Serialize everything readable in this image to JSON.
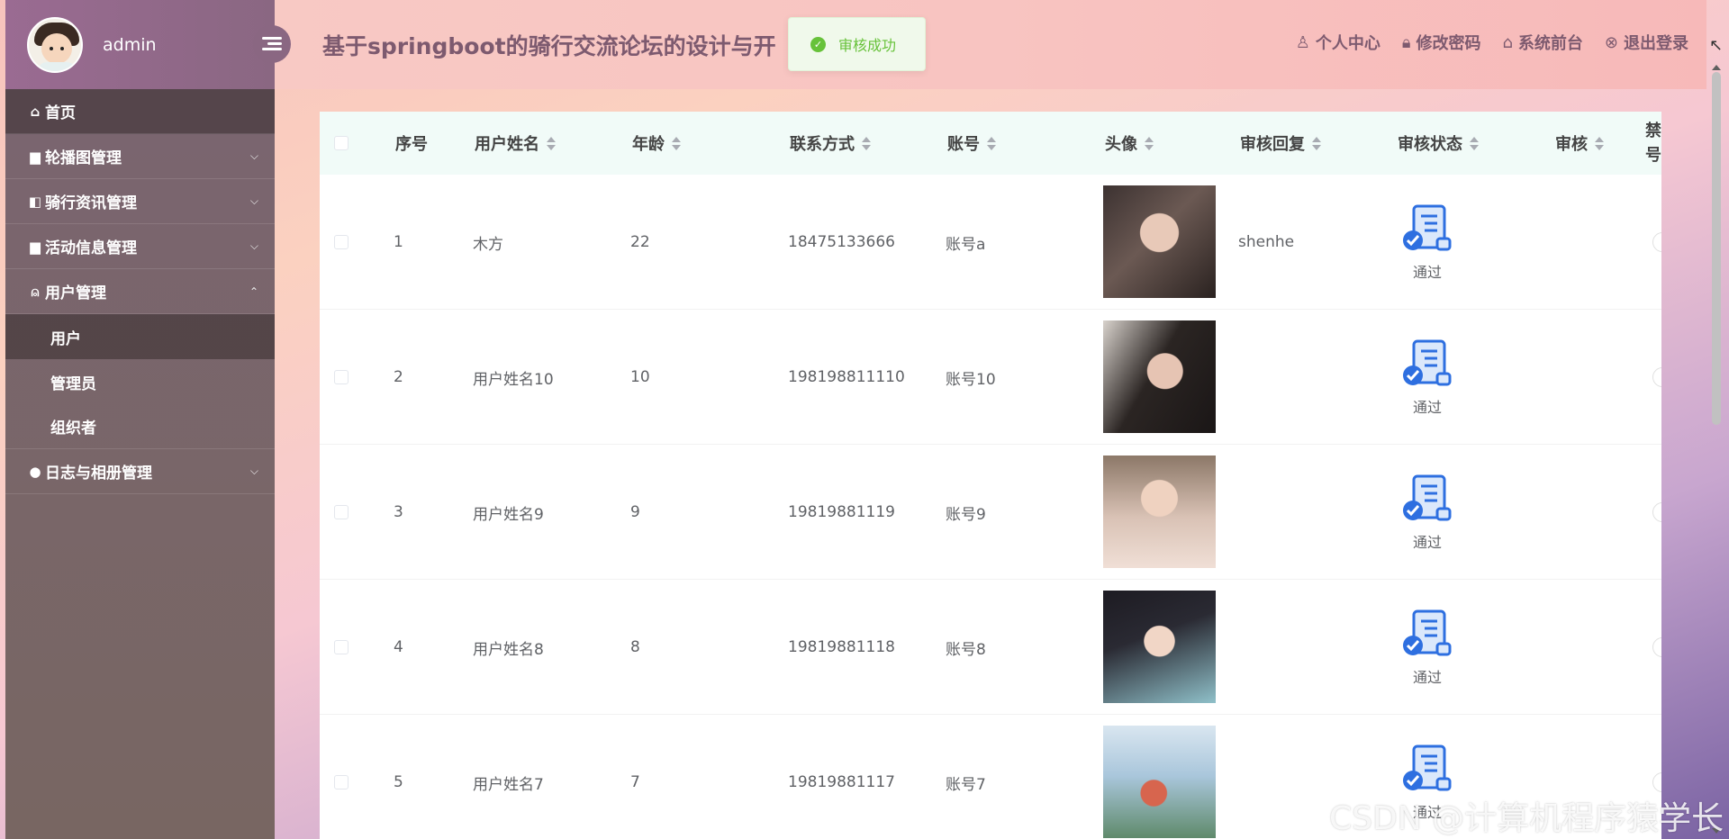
{
  "sidebar": {
    "admin_name": "admin",
    "menu": [
      {
        "label": "首页",
        "icon": "home-icon"
      },
      {
        "label": "轮播图管理",
        "icon": "image-icon"
      },
      {
        "label": "骑行资讯管理",
        "icon": "news-icon"
      },
      {
        "label": "活动信息管理",
        "icon": "calendar-icon"
      },
      {
        "label": "用户管理",
        "icon": "user-lock-icon"
      },
      {
        "label": "日志与相册管理",
        "icon": "more-icon"
      }
    ],
    "submenu": [
      {
        "label": "用户"
      },
      {
        "label": "管理员"
      },
      {
        "label": "组织者"
      }
    ]
  },
  "header": {
    "title": "基于springboot的骑行交流论坛的设计与开",
    "links": [
      {
        "label": "个人中心",
        "icon": "user-icon"
      },
      {
        "label": "修改密码",
        "icon": "lock-icon"
      },
      {
        "label": "系统前台",
        "icon": "home-icon"
      },
      {
        "label": "退出登录",
        "icon": "logout-icon"
      }
    ]
  },
  "toast": {
    "text": "审核成功",
    "color": "#67c23a"
  },
  "table": {
    "columns": [
      "序号",
      "用户姓名",
      "年龄",
      "联系方式",
      "账号",
      "头像",
      "审核回复",
      "审核状态",
      "审核",
      "禁号"
    ],
    "rows": [
      {
        "index": "1",
        "name": "木方",
        "age": "22",
        "phone": "18475133666",
        "account": "账号a",
        "reply": "shenhe",
        "status": "通过"
      },
      {
        "index": "2",
        "name": "用户姓名10",
        "age": "10",
        "phone": "198198811110",
        "account": "账号10",
        "reply": "",
        "status": "通过"
      },
      {
        "index": "3",
        "name": "用户姓名9",
        "age": "9",
        "phone": "19819881119",
        "account": "账号9",
        "reply": "",
        "status": "通过"
      },
      {
        "index": "4",
        "name": "用户姓名8",
        "age": "8",
        "phone": "19819881118",
        "account": "账号8",
        "reply": "",
        "status": "通过"
      },
      {
        "index": "5",
        "name": "用户姓名7",
        "age": "7",
        "phone": "19819881117",
        "account": "账号7",
        "reply": "",
        "status": "通过"
      }
    ]
  },
  "watermark": "CSDN @计算机程序猿学长",
  "colors": {
    "accent": "#7d5a6f",
    "header_bg": "#f1fbf8",
    "status_icon": "#2e6fe0"
  }
}
